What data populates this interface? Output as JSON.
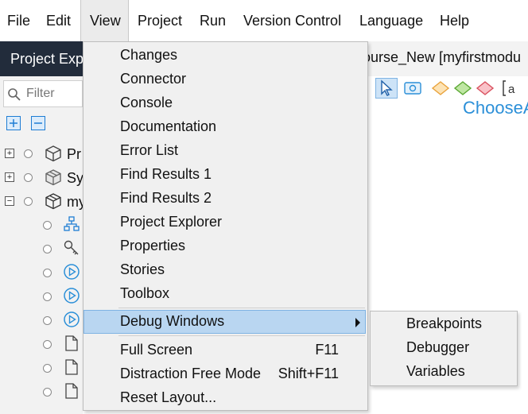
{
  "menubar": {
    "items": [
      "File",
      "Edit",
      "View",
      "Project",
      "Run",
      "Version Control",
      "Language",
      "Help"
    ],
    "active": "View"
  },
  "sidebar": {
    "title": "Project Exp",
    "filter_placeholder": "Filter",
    "tree": [
      {
        "label": "Pr",
        "expander": "+",
        "icon": "cube-icon"
      },
      {
        "label": "Sy",
        "expander": "+",
        "icon": "package-icon"
      },
      {
        "label": "my",
        "expander": "−",
        "icon": "package-icon"
      }
    ]
  },
  "editor": {
    "tab_title": "ourse_New [myfirstmodu",
    "canvas_text": "ChooseA"
  },
  "view_menu": {
    "items": [
      {
        "label": "Changes",
        "shortcut": ""
      },
      {
        "label": "Connector",
        "shortcut": ""
      },
      {
        "label": "Console",
        "shortcut": ""
      },
      {
        "label": "Documentation",
        "shortcut": ""
      },
      {
        "label": "Error List",
        "shortcut": ""
      },
      {
        "label": "Find Results 1",
        "shortcut": ""
      },
      {
        "label": "Find Results 2",
        "shortcut": ""
      },
      {
        "label": "Project Explorer",
        "shortcut": ""
      },
      {
        "label": "Properties",
        "shortcut": ""
      },
      {
        "label": "Stories",
        "shortcut": ""
      },
      {
        "label": "Toolbox",
        "shortcut": ""
      },
      {
        "label": "Debug Windows",
        "shortcut": "",
        "submenu": true
      },
      {
        "label": "Full Screen",
        "shortcut": "F11"
      },
      {
        "label": "Distraction Free Mode",
        "shortcut": "Shift+F11"
      },
      {
        "label": "Reset Layout...",
        "shortcut": ""
      }
    ]
  },
  "debug_submenu": {
    "items": [
      "Breakpoints",
      "Debugger",
      "Variables"
    ]
  },
  "colors": {
    "highlight": "#b9d6f1",
    "sidebar_header": "#222c3b",
    "accent_blue": "#2b8fd8"
  }
}
